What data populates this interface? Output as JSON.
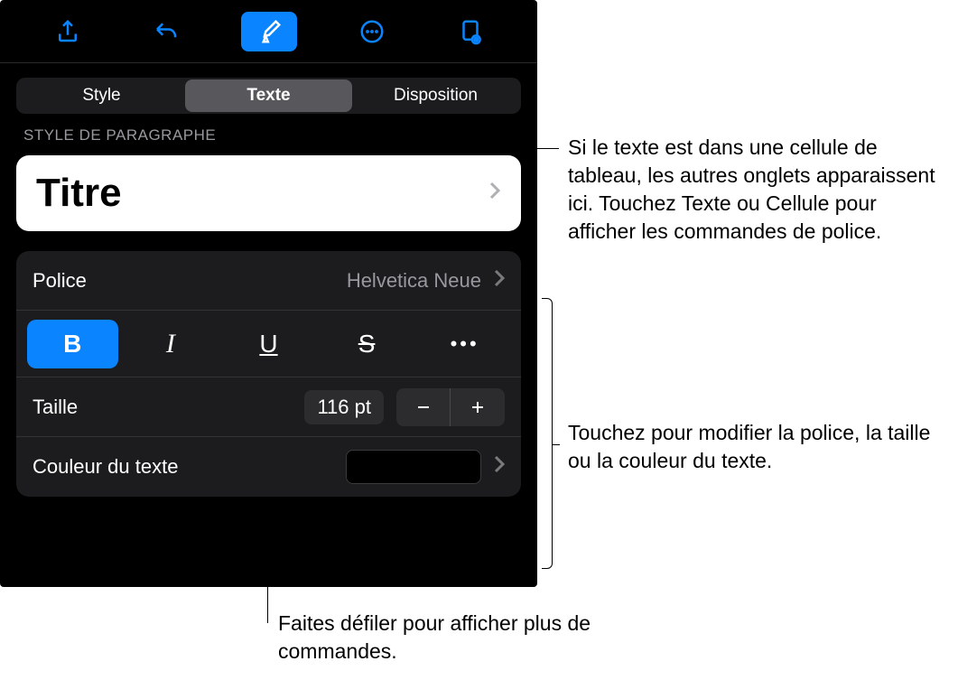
{
  "tabs": {
    "style": "Style",
    "texte": "Texte",
    "disposition": "Disposition"
  },
  "section": {
    "paragraph": "STYLE DE PARAGRAPHE"
  },
  "paragraphStyle": {
    "title": "Titre"
  },
  "font": {
    "label": "Police",
    "value": "Helvetica Neue"
  },
  "format": {
    "bold": "B",
    "italic": "I",
    "underline": "U",
    "strike": "S",
    "more": "•••"
  },
  "size": {
    "label": "Taille",
    "value": "116 pt"
  },
  "textColor": {
    "label": "Couleur du texte"
  },
  "callouts": {
    "c1": "Si le texte est dans une cellule de tableau, les autres onglets apparaissent ici. Touchez Texte ou Cellule pour afficher les commandes de police.",
    "c2": "Touchez pour modifier la police, la taille ou la couleur du texte.",
    "c3": "Faites défiler pour afficher plus de commandes."
  }
}
